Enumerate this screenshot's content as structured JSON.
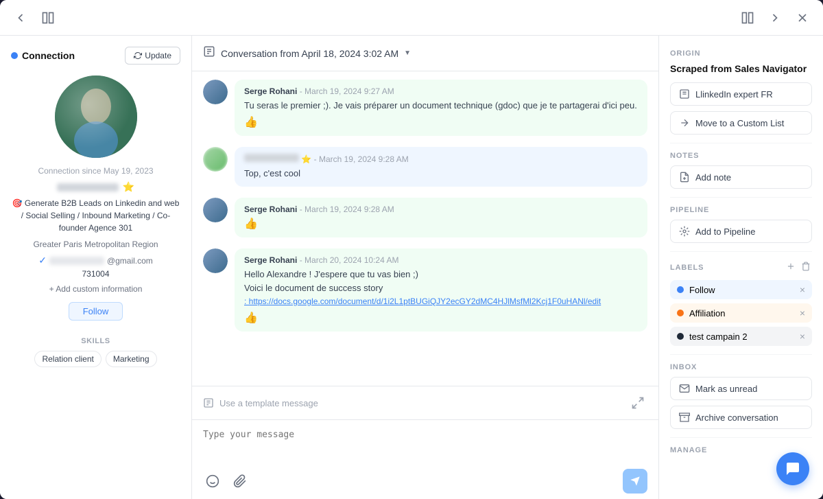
{
  "topbar": {
    "back_icon": "←",
    "layout_icon": "⊡",
    "layout_icon2": "⊡",
    "forward_icon": "→",
    "close_icon": "✕"
  },
  "leftPanel": {
    "connection_label": "Connection",
    "update_btn": "Update",
    "connection_since": "Connection since May 19, 2023",
    "bio": "🎯 Generate B2B Leads on Linkedin and web / Social Selling / Inbound Marketing / Co-founder Agence 301",
    "location": "Greater Paris Metropolitan Region",
    "email_suffix": "@gmail.com",
    "phone": "731004",
    "add_custom_label": "+ Add custom information",
    "follow_btn": "Follow",
    "skills_label": "SKILLS",
    "skills": [
      "Relation client",
      "Marketing"
    ]
  },
  "centerPanel": {
    "convo_title": "Conversation from April 18, 2024 3:02 AM",
    "messages": [
      {
        "id": 1,
        "sender": "Serge Rohani",
        "time": "March 19, 2024 9:27 AM",
        "text": "Tu seras le premier ;). Je vais préparer un document technique (gdoc) que je te partagerai d'ici peu.",
        "emoji": "👍",
        "type": "sent",
        "style": "green"
      },
      {
        "id": 2,
        "sender": "",
        "time": "March 19, 2024 9:28 AM",
        "text": "Top, c'est cool",
        "emoji": "",
        "type": "received",
        "style": "blue"
      },
      {
        "id": 3,
        "sender": "Serge Rohani",
        "time": "March 19, 2024 9:28 AM",
        "text": "👍",
        "emoji": "",
        "type": "sent",
        "style": "green"
      },
      {
        "id": 4,
        "sender": "Serge Rohani",
        "time": "March 20, 2024 10:24 AM",
        "text": "Hello Alexandre ! J'espere que tu vas bien ;)\nVoici le document de success story",
        "link": "https://docs.google.com/document/d/1i2L1ptBUGiQJY2ecGY2dMC4HJlMsfMl2Kcj1F0uHANl/edit",
        "emoji": "👍",
        "type": "sent",
        "style": "green"
      }
    ],
    "template_placeholder": "Use a template message",
    "compose_placeholder": "Type your message"
  },
  "rightPanel": {
    "origin_section": "ORIGIN",
    "origin_title": "Scraped from Sales Navigator",
    "linkedin_list_label": "LlinkedIn expert FR",
    "move_list_label": "Move to a Custom List",
    "notes_section": "NOTES",
    "add_note_label": "Add note",
    "pipeline_section": "PIPELINE",
    "add_pipeline_label": "Add to Pipeline",
    "labels_section": "LABELS",
    "labels": [
      {
        "name": "Follow",
        "color": "blue",
        "style": "follow"
      },
      {
        "name": "Affiliation",
        "color": "orange",
        "style": "affiliation"
      },
      {
        "name": "test campain 2",
        "color": "dark",
        "style": "campaign"
      }
    ],
    "inbox_section": "INBOX",
    "mark_unread_label": "Mark as unread",
    "archive_label": "Archive conversation",
    "manage_section": "MANAGE"
  }
}
